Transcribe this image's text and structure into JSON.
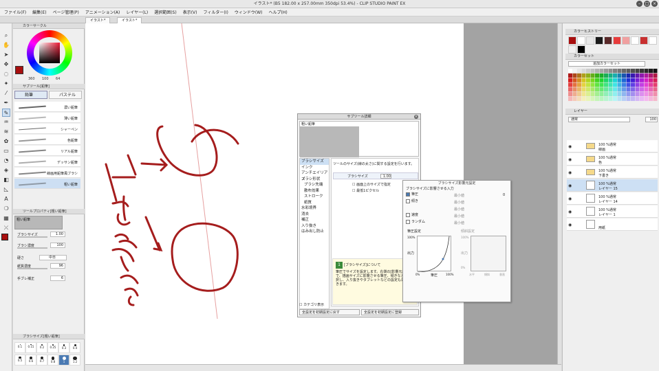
{
  "window": {
    "title": "イラスト* (B5 182.00 x 257.00mm 350dpi 53.4%)  - CLIP STUDIO PAINT EX"
  },
  "menu": [
    "ファイル(F)",
    "編集(E)",
    "ページ管理(P)",
    "アニメーション(A)",
    "レイヤー(L)",
    "選択範囲(S)",
    "表示(V)",
    "フィルター(I)",
    "ウィンドウ(W)",
    "ヘルプ(H)"
  ],
  "tabs": [
    "イラスト*",
    "イラスト*"
  ],
  "color_wheel": {
    "panel_title": "カラーサークル",
    "h": "360",
    "s": "100",
    "v": "64",
    "main_color": "#a80f0f",
    "accent": "#f01a36"
  },
  "subtool": {
    "panel_title": "サブツール[鉛筆]",
    "tab_pencil": "鉛筆",
    "tab_pastel": "パステル",
    "brushes": [
      "濃い鉛筆",
      "薄い鉛筆",
      "シャーペン",
      "色鉛筆",
      "リアル鉛筆",
      "デッサン鉛筆",
      "線画用鉛筆風ブラシ",
      "粗い鉛筆"
    ],
    "selected_index": 7
  },
  "toolprop": {
    "panel_title": "ツールプロパティ[粗い鉛筆]",
    "name": "粗い鉛筆",
    "brush_size_label": "ブラシサイズ",
    "brush_size_value": "1.00",
    "density_label": "ブラシ濃度",
    "density_value": "100",
    "hardness_label": "硬さ",
    "hardness_value": "中日",
    "paper_density_label": "紙質濃度",
    "paper_density_value": "96",
    "stabilize_label": "手ブレ補正",
    "stabilize_value": "6"
  },
  "size_palette": {
    "panel_title": "ブラシサイズ[粗い鉛筆]",
    "sizes": [
      "0.1",
      "0.15",
      "0.2",
      "0.25",
      "0.3",
      "0.4",
      "0.5",
      "0.6",
      "0.7",
      "0.8",
      "1",
      "1.2"
    ],
    "selected_index": 10
  },
  "subtool_detail": {
    "title": "サブツール詳細",
    "preview_label": "粗い鉛筆",
    "categories": [
      "ブラシサイズ",
      "インク",
      "アンチエイリアス",
      "ブラシ形状",
      "ブラシ先端",
      "散布効果",
      "ストローク",
      "紙質",
      "水彩境界",
      "消去",
      "補正",
      "入り抜き",
      "はみ出し防止"
    ],
    "indented": [
      4,
      5,
      6,
      7
    ],
    "selected_index": 0,
    "description": "ツールのサイズ(線の太さ)に関する設定を行います。",
    "brush_size_label": "ブラシサイズ",
    "brush_size_value": "1.00",
    "check_screen": "画面上のサイズで指定",
    "check_min_pixel": "最低1ピクセル",
    "help_title": "[ブラシサイズ]について",
    "help_text": "筆圧でサイズを設定します。右側の[影響元設定]で、描画サイズに影響させる筆圧、傾きなどを選択し、入り抜きやタブレットなどの設定も選択できます。",
    "show_category": "カテゴリ表示",
    "reset_button": "全設定を初期設定に戻す",
    "register_button": "全設定を初期設定に登録"
  },
  "pressure_popup": {
    "title": "ブラシサイズ影響元設定",
    "header": "ブラシサイズに影響させる入力",
    "items": [
      "筆圧",
      "傾き",
      "速度",
      "ランダム"
    ],
    "min_label": "最小値",
    "min_value": "0",
    "graph_title": "筆圧設定",
    "tilt_title": "傾斜設定",
    "y_axis": "出力",
    "y_100": "100%",
    "y_0": "0%",
    "x_label": "筆圧",
    "x_100": "100%",
    "x_0": "0%",
    "tilt_x": [
      "水平",
      "傾斜",
      "垂直"
    ]
  },
  "history": {
    "panel_title": "カラーヒストリー",
    "colors": [
      "#a80f0f",
      "#ffffff",
      "#e8e8e8",
      "#1a1a1a",
      "#5a2a2a",
      "#e83c3c",
      "#f0a0a0",
      "#ffffff",
      "#c83030",
      "#ffffff",
      "#f0f0f0",
      "#000000"
    ]
  },
  "color_set": {
    "panel_title": "カラーセット",
    "set_name": "追加カラーセット"
  },
  "layers": {
    "panel_title": "レイヤー",
    "blend": "通常",
    "opacity": "100",
    "items": [
      {
        "l1": "100 %通常",
        "l2": "線画"
      },
      {
        "l1": "100 %通常",
        "l2": "色"
      },
      {
        "l1": "100 %通常",
        "l2": "下書き"
      },
      {
        "l1": "100 %通常",
        "l2": "レイヤー 15"
      },
      {
        "l1": "100 %通常",
        "l2": "レイヤー 14"
      },
      {
        "l1": "100 %通常",
        "l2": "レイヤー 1"
      },
      {
        "l1": "",
        "l2": "用紙"
      }
    ],
    "selected_index": 3
  },
  "canvas": {
    "ink": "#a51d1d"
  }
}
